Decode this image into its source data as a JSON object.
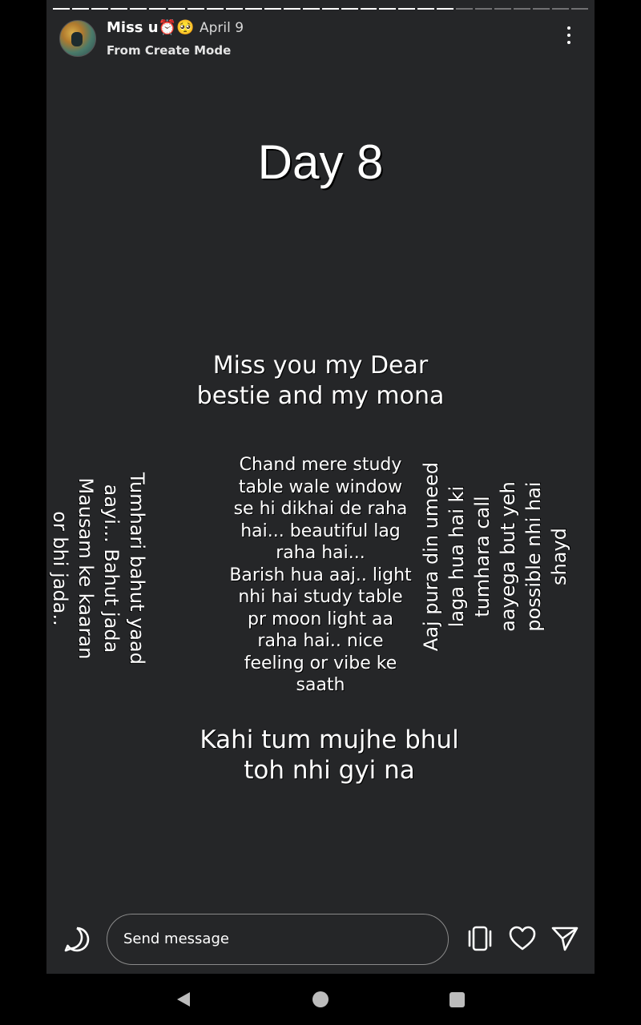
{
  "header": {
    "username": "Miss u⏰🥺",
    "date": "April 9",
    "subtitle": "From Create Mode",
    "progress_total": 28,
    "progress_completed": 21
  },
  "story": {
    "title": "Day 8",
    "miss_lines": [
      "Miss you my Dear",
      "bestie and my mona"
    ],
    "left_vertical_lines": [
      "Tumhari bahut yaad",
      "aayi... Bahut jada",
      "Mausam ke kaaran",
      "or bhi jada.."
    ],
    "center_lines": [
      "Chand mere study",
      "table wale window",
      "se hi dikhai de raha",
      "hai... beautiful lag",
      "raha hai...",
      "Barish hua aaj.. light",
      "nhi hai study table",
      "pr moon light aa",
      "raha hai.. nice",
      "feeling or vibe ke",
      "saath"
    ],
    "right_vertical_lines": [
      "Aaj pura din umeed",
      "laga hua hai ki",
      "tumhara call",
      "aayega but yeh",
      "possible nhi hai",
      "shayd"
    ],
    "bottom_lines": [
      "Kahi tum mujhe bhul",
      "toh nhi gyi na"
    ]
  },
  "footer": {
    "message_placeholder": "Send message",
    "icons": [
      "reply-icon",
      "repost-icon",
      "heart-icon",
      "send-icon"
    ]
  },
  "navbar": {
    "icons": [
      "back-icon",
      "home-icon",
      "recents-icon"
    ]
  }
}
